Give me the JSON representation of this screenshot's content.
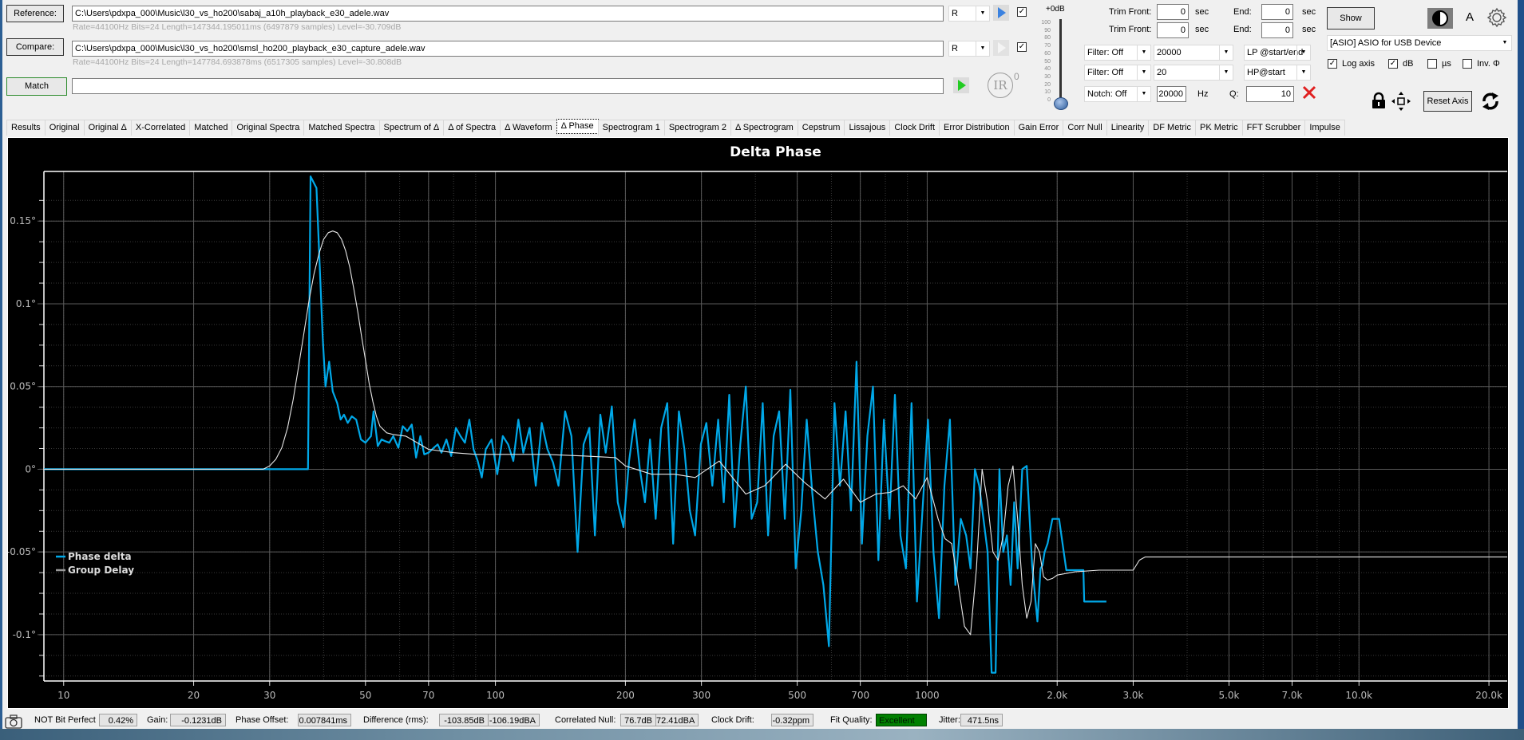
{
  "files": {
    "reference_label": "Reference:",
    "reference_path": "C:\\Users\\pdxpa_000\\Music\\l30_vs_ho200\\sabaj_a10h_playback_e30_adele.wav",
    "reference_info": "Rate=44100Hz Bits=24 Length=147344.195011ms (6497879 samples) Level=-30.709dB",
    "reference_channel": "R",
    "compare_label": "Compare:",
    "compare_path": "C:\\Users\\pdxpa_000\\Music\\l30_vs_ho200\\smsl_ho200_playback_e30_capture_adele.wav",
    "compare_info": "Rate=44100Hz Bits=24 Length=147784.693878ms (6517305 samples) Level=-30.808dB",
    "compare_channel": "R",
    "match_label": "Match",
    "match_value": ""
  },
  "level": {
    "title": "+0dB",
    "ticks": [
      "100",
      "90",
      "80",
      "70",
      "60",
      "50",
      "40",
      "30",
      "20",
      "10",
      "0"
    ],
    "value_db": 0
  },
  "ir": {
    "label": "IR",
    "count": "0"
  },
  "trim": {
    "front_label": "Trim Front:",
    "front1": "0",
    "front2": "0",
    "unit": "sec",
    "end_label": "End:",
    "end1": "0",
    "end2": "0"
  },
  "filters": {
    "filter1": "Filter: Off",
    "filter1_freq": "20000",
    "filter1_mode": "LP @start/end",
    "filter2": "Filter: Off",
    "filter2_freq": "20",
    "filter2_mode": "HP@start",
    "notch": "Notch: Off",
    "notch_freq": "20000",
    "notch_unit": "Hz",
    "q_label": "Q:",
    "q_value": "10"
  },
  "right_panel": {
    "show_label": "Show",
    "font_label": "A",
    "device": "[ASIO] ASIO for USB Device",
    "log_axis": "Log axis",
    "log_axis_checked": true,
    "db": "dB",
    "db_checked": true,
    "us": "µs",
    "us_checked": false,
    "inv": "Inv. Φ",
    "inv_checked": false,
    "reset_axis": "Reset Axis"
  },
  "tabs": [
    "Results",
    "Original",
    "Original Δ",
    "X-Correlated",
    "Matched",
    "Original Spectra",
    "Matched Spectra",
    "Spectrum of Δ",
    "Δ of Spectra",
    "Δ Waveform",
    "Δ Phase",
    "Spectrogram 1",
    "Spectrogram 2",
    "Δ Spectrogram",
    "Cepstrum",
    "Lissajous",
    "Clock Drift",
    "Error Distribution",
    "Gain Error",
    "Corr Null",
    "Linearity",
    "DF Metric",
    "PK Metric",
    "FFT Scrubber",
    "Impulse"
  ],
  "active_tab": "Δ Phase",
  "status": {
    "bit_perfect": "NOT Bit Perfect",
    "bit_perfect_value": "0.42%",
    "gain_label": "Gain:",
    "gain": "-0.1231dB",
    "phase_offset_label": "Phase Offset:",
    "phase_offset": "0.007841ms",
    "difference_label": "Difference (rms):",
    "difference_db": "-103.85dB",
    "difference_dba": "-106.19dBA",
    "corr_null_label": "Correlated Null:",
    "corr_null_db": "76.7dB",
    "corr_null_dba": "72.41dBA",
    "clock_drift_label": "Clock Drift:",
    "clock_drift": "-0.32ppm",
    "fit_quality_label": "Fit Quality:",
    "fit_quality": "Excellent",
    "jitter_label": "Jitter:",
    "jitter": "471.5ns"
  },
  "colors": {
    "phase_delta": "#00a8e8",
    "group_delay": "#e8e8e8",
    "fit_excellent": "#008000"
  },
  "chart_data": {
    "type": "line",
    "title": "Delta Phase",
    "xlabel": "",
    "ylabel": "",
    "xscale": "log",
    "xlim": [
      9,
      22050
    ],
    "ylim": [
      -0.128,
      0.18
    ],
    "grid": true,
    "legend_placement": "bottom-left",
    "x_ticks": [
      10,
      20,
      30,
      50,
      70,
      100,
      200,
      300,
      500,
      700,
      1000,
      2000,
      3000,
      5000,
      7000,
      10000,
      20000
    ],
    "x_tick_labels": [
      "10",
      "20",
      "30",
      "50",
      "70",
      "100",
      "200",
      "300",
      "500",
      "700",
      "1000",
      "2.0k",
      "3.0k",
      "5.0k",
      "7.0k",
      "10.0k",
      "20.0k"
    ],
    "y_ticks": [
      0.15,
      0.1,
      0.05,
      0,
      -0.05,
      -0.1
    ],
    "y_tick_labels": [
      "0.15°",
      "0.1°",
      "0.05°",
      "0°",
      "-0.05°",
      "-0.1°"
    ],
    "series": [
      {
        "name": "Phase delta",
        "x": [
          9,
          36.8,
          37.3,
          38.5,
          39.8,
          40.4,
          41.2,
          42.0,
          43.0,
          43.8,
          44.6,
          45.5,
          46.5,
          47.6,
          48.8,
          50,
          51.5,
          52.2,
          53.4,
          54.5,
          55.5,
          56.8,
          58,
          59.6,
          61,
          62.5,
          64,
          65.5,
          67,
          68.4,
          70,
          72,
          73.5,
          75,
          77,
          79,
          81,
          83,
          85,
          87,
          89,
          91,
          93,
          95,
          98,
          101,
          104,
          107,
          110,
          113,
          116,
          120,
          124,
          128,
          132,
          136,
          140,
          145,
          150,
          155,
          160,
          165,
          170,
          175,
          180,
          186,
          192,
          198,
          204,
          210,
          216,
          222,
          228,
          235,
          242,
          250,
          258,
          266,
          274,
          282,
          290,
          299,
          308,
          318,
          328,
          338,
          348,
          358,
          369,
          380,
          392,
          404,
          416,
          428,
          441,
          454,
          468,
          482,
          496,
          511,
          526,
          542,
          558,
          575,
          592,
          610,
          628,
          647,
          666,
          686,
          706,
          727,
          749,
          771,
          794,
          818,
          842,
          867,
          893,
          920,
          947,
          975,
          1004,
          1034,
          1065,
          1096,
          1129,
          1162,
          1196,
          1231,
          1260,
          1290,
          1320,
          1350,
          1380,
          1410,
          1440,
          1470,
          1500,
          1530,
          1560,
          1590,
          1620,
          1660,
          1700,
          1750,
          1800,
          1830,
          1850,
          1870,
          1900,
          1950,
          2020,
          2100,
          2300,
          2310,
          2600,
          2800,
          2810,
          22050
        ],
        "y": [
          0,
          0,
          0.177,
          0.17,
          0.08,
          0.05,
          0.065,
          0.047,
          0.04,
          0.03,
          0.033,
          0.028,
          0.032,
          0.03,
          0.018,
          0.016,
          0.02,
          0.035,
          0.014,
          0.018,
          0.017,
          0.016,
          0.02,
          0.013,
          0.026,
          0.023,
          0.027,
          0.007,
          0.02,
          0.009,
          0.01,
          0.013,
          0.015,
          0.01,
          0.018,
          0.008,
          0.025,
          0.02,
          0.016,
          0.03,
          0.012,
          0.005,
          -0.005,
          0.012,
          0.018,
          -0.003,
          0.02,
          0.015,
          0.005,
          0.03,
          0.01,
          0.025,
          -0.01,
          0.028,
          0.012,
          0.004,
          -0.01,
          0.035,
          0.02,
          -0.05,
          0.015,
          0.025,
          -0.04,
          0.033,
          0.01,
          0.038,
          -0.02,
          -0.035,
          0.005,
          0.03,
          0.0,
          -0.02,
          0.018,
          -0.03,
          0.025,
          0.04,
          -0.045,
          0.035,
          0.012,
          -0.025,
          -0.04,
          0.015,
          0.028,
          -0.01,
          0.03,
          -0.02,
          0.045,
          -0.035,
          0.015,
          0.05,
          -0.03,
          -0.02,
          0.04,
          -0.04,
          0.02,
          0.035,
          -0.03,
          0.048,
          -0.06,
          -0.025,
          0.03,
          -0.015,
          -0.05,
          -0.07,
          -0.107,
          0.04,
          -0.01,
          0.035,
          -0.025,
          0.065,
          -0.045,
          0.02,
          0.05,
          -0.055,
          0.03,
          -0.03,
          0.045,
          -0.04,
          -0.06,
          0.04,
          -0.08,
          -0.025,
          0.03,
          -0.05,
          -0.09,
          -0.01,
          0.03,
          -0.07,
          -0.03,
          -0.04,
          -0.06,
          0.0,
          -0.01,
          -0.03,
          -0.05,
          -0.123,
          -0.123,
          0.0,
          -0.05,
          -0.04,
          -0.07,
          -0.02,
          -0.06,
          0.0,
          0.002,
          -0.058,
          -0.092,
          -0.06,
          -0.058,
          -0.05,
          -0.045,
          -0.03,
          -0.03,
          -0.061,
          -0.061,
          -0.08,
          -0.08
        ]
      },
      {
        "name": "Group Delay",
        "x": [
          9,
          29,
          30,
          31,
          32,
          33,
          34,
          35,
          36,
          37,
          38,
          39,
          40,
          41,
          42,
          43,
          44,
          45,
          46,
          47,
          48,
          49,
          50,
          51,
          52,
          53,
          54,
          56,
          58,
          62,
          70,
          80,
          90,
          100,
          130,
          160,
          190,
          200,
          230,
          260,
          290,
          330,
          380,
          420,
          470,
          520,
          580,
          640,
          700,
          760,
          820,
          880,
          940,
          1000,
          1060,
          1100,
          1140,
          1180,
          1220,
          1260,
          1300,
          1340,
          1380,
          1420,
          1460,
          1500,
          1540,
          1580,
          1620,
          1660,
          1700,
          1740,
          1780,
          1820,
          1860,
          1900,
          1950,
          2000,
          2200,
          2500,
          3000,
          3100,
          3200,
          22050
        ],
        "y": [
          0,
          0,
          0.002,
          0.006,
          0.013,
          0.025,
          0.042,
          0.062,
          0.082,
          0.102,
          0.118,
          0.13,
          0.139,
          0.143,
          0.144,
          0.143,
          0.139,
          0.132,
          0.122,
          0.109,
          0.095,
          0.08,
          0.066,
          0.052,
          0.041,
          0.032,
          0.026,
          0.022,
          0.021,
          0.02,
          0.012,
          0.01,
          0.009,
          0.009,
          0.009,
          0.008,
          0.007,
          0.002,
          -0.003,
          -0.003,
          -0.005,
          0.005,
          -0.015,
          -0.01,
          0.003,
          -0.008,
          -0.018,
          -0.006,
          -0.02,
          -0.015,
          -0.014,
          -0.01,
          -0.018,
          -0.005,
          -0.03,
          -0.042,
          -0.045,
          -0.07,
          -0.095,
          -0.1,
          -0.06,
          0.0,
          -0.02,
          -0.05,
          -0.055,
          -0.04,
          -0.01,
          0.002,
          -0.03,
          -0.07,
          -0.09,
          -0.08,
          -0.045,
          -0.05,
          -0.065,
          -0.067,
          -0.066,
          -0.064,
          -0.062,
          -0.061,
          -0.061,
          -0.055,
          -0.053,
          -0.053
        ]
      }
    ]
  }
}
